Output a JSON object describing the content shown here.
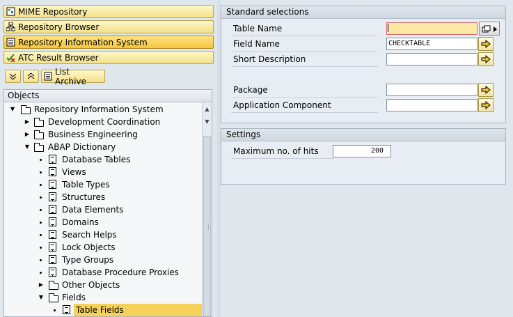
{
  "nav": {
    "mime": "MIME Repository",
    "browser": "Repository Browser",
    "ris": "Repository Information System",
    "atc": "ATC Result Browser"
  },
  "toolbar": {
    "list_archive": "List Archive"
  },
  "tree": {
    "header": "Objects",
    "items": {
      "root": "Repository Information System",
      "dev": "Development Coordination",
      "biz": "Business Engineering",
      "abap": "ABAP Dictionary",
      "dbtables": "Database Tables",
      "views": "Views",
      "tabletypes": "Table Types",
      "structures": "Structures",
      "dataelements": "Data Elements",
      "domains": "Domains",
      "searchhelps": "Search Helps",
      "lockobjects": "Lock Objects",
      "typegroups": "Type Groups",
      "dbproxies": "Database Procedure Proxies",
      "otherobjects": "Other Objects",
      "fields": "Fields",
      "tablefields": "Table Fields"
    }
  },
  "standard": {
    "title": "Standard selections",
    "table_name_label": "Table Name",
    "table_name_value": "",
    "field_name_label": "Field Name",
    "field_name_value": "CHECKTABLE",
    "short_desc_label": "Short Description",
    "short_desc_value": "",
    "package_label": "Package",
    "package_value": "",
    "app_comp_label": "Application Component",
    "app_comp_value": ""
  },
  "settings": {
    "title": "Settings",
    "max_hits_label": "Maximum no. of hits",
    "max_hits_value": "200"
  },
  "colors": {
    "accent": "#f6d25a",
    "button": "#f3e08a",
    "panel": "#dfe6ec"
  }
}
